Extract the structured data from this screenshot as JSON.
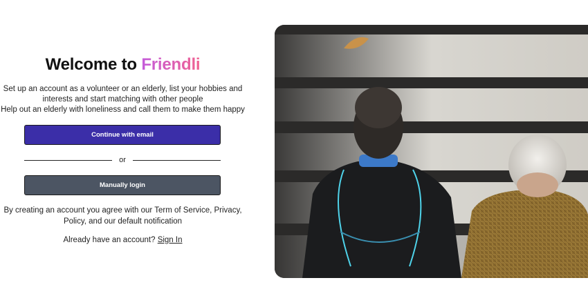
{
  "welcome": {
    "title_prefix": "Welcome to",
    "brand": "Friendli"
  },
  "description": {
    "line1": "Set up an account as a volunteer or an elderly, list your hobbies and",
    "line2": "interests and start matching with other people",
    "line3": "Help out an elderly with loneliness and call them to make them happy"
  },
  "buttons": {
    "email": "Continue with email",
    "divider": "or",
    "login": "Manually login"
  },
  "terms": {
    "line1": "By creating an account you agree with our Term of Service, Privacy,",
    "line2": "Policy, and our default notification"
  },
  "signin": {
    "prompt": "Already have an account?",
    "link": "Sign In"
  },
  "colors": {
    "primary_button": "#3b2ea8",
    "secondary_button": "#4c5563",
    "brand_gradient_start": "#c45cdb",
    "brand_gradient_end": "#f06292"
  }
}
